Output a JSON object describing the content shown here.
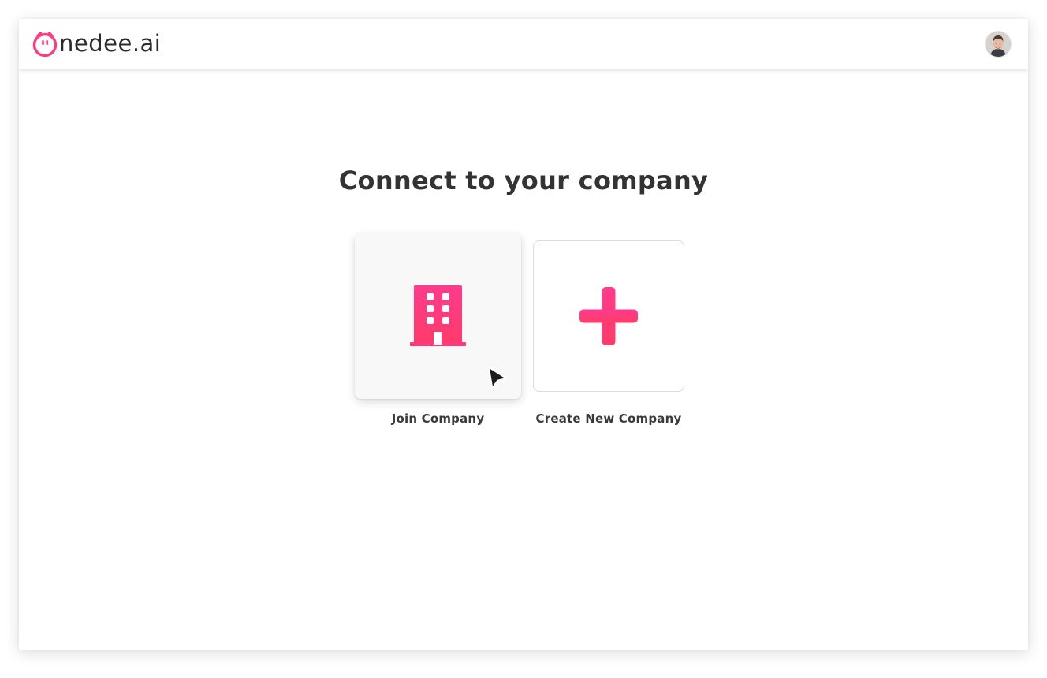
{
  "app": {
    "name": "Onedee.ai",
    "logo_text": "nedee.ai"
  },
  "header": {
    "avatar_alt": "User avatar"
  },
  "main": {
    "title": "Connect to your company",
    "options": [
      {
        "label": "Join Company",
        "icon": "building-icon"
      },
      {
        "label": "Create New Company",
        "icon": "plus-icon"
      }
    ]
  },
  "colors": {
    "accent": "#ff3b7f",
    "accent_dark": "#e8286d",
    "text_dark": "#333333"
  }
}
